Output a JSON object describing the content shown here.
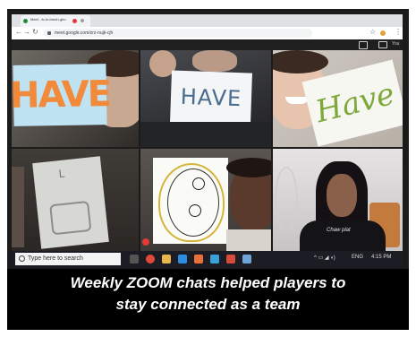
{
  "browser": {
    "tab_title": "Meet - fc-kr-bmuh-gbo",
    "url": "meet.google.com/zrz-nujk-cjh",
    "nav_back": "←",
    "nav_forward": "→",
    "nav_reload": "↻",
    "star": "☆",
    "menu": "⋮",
    "profile": "You"
  },
  "tiles": {
    "card1": "HAVE",
    "card2": "HAVE",
    "card3": "Have",
    "sketch_top_mark": "L"
  },
  "taskbar": {
    "search_placeholder": "Type here to search",
    "language": "ENG",
    "clock": "4:15 PM"
  },
  "shirt_text": "Chaw plat",
  "caption": {
    "line1": "Weekly ZOOM  chats helped players to",
    "line2": "stay connected as a team"
  }
}
